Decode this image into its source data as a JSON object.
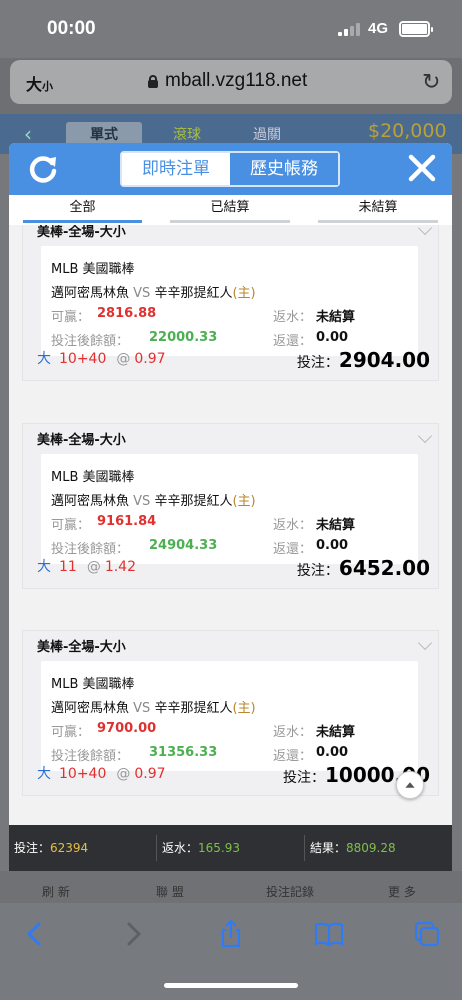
{
  "status_bar": {
    "time": "00:00",
    "network": "4G"
  },
  "url_bar": {
    "reader_label_big": "大",
    "reader_label_small": "小",
    "url": "mball.vzg118.net"
  },
  "background_site": {
    "tabs": [
      "單式",
      "滾球",
      "過關"
    ],
    "balance": "$20,000",
    "bottom_nav": [
      "刷 新",
      "聯 盟",
      "投注記錄",
      "更 多"
    ]
  },
  "modal": {
    "segments": [
      "即時注單",
      "歷史帳務"
    ],
    "filter_tabs": [
      "全部",
      "已結算",
      "未結算"
    ],
    "first_card_title": "美棒-全場-大小",
    "cards": [
      {
        "title": "美棒-全場-大小",
        "league": "MLB 美國職棒",
        "team_away": "邁阿密馬林魚",
        "vs": "VS",
        "team_home": "辛辛那提紅人",
        "home_marker": "(主)",
        "win_label": "可贏：",
        "win_value": "2816.88",
        "remaining_label": "投注後餘額：",
        "remaining_value": "22000.33",
        "rebate_label": "返水：",
        "rebate_value": "未結算",
        "return_label": "返還：",
        "return_value": "0.00",
        "pick_side": "大",
        "pick_line": "10+40",
        "at": "@",
        "odds": "0.97",
        "stake_label": "投注：",
        "stake_value": "2904.00"
      },
      {
        "title": "美棒-全場-大小",
        "league": "MLB 美國職棒",
        "team_away": "邁阿密馬林魚",
        "vs": "VS",
        "team_home": "辛辛那提紅人",
        "home_marker": "(主)",
        "win_label": "可贏：",
        "win_value": "9161.84",
        "remaining_label": "投注後餘額：",
        "remaining_value": "24904.33",
        "rebate_label": "返水：",
        "rebate_value": "未結算",
        "return_label": "返還：",
        "return_value": "0.00",
        "pick_side": "大",
        "pick_line": "11",
        "at": "@",
        "odds": "1.42",
        "stake_label": "投注：",
        "stake_value": "6452.00"
      },
      {
        "title": "美棒-全場-大小",
        "league": "MLB 美國職棒",
        "team_away": "邁阿密馬林魚",
        "vs": "VS",
        "team_home": "辛辛那提紅人",
        "home_marker": "(主)",
        "win_label": "可贏：",
        "win_value": "9700.00",
        "remaining_label": "投注後餘額：",
        "remaining_value": "31356.33",
        "rebate_label": "返水：",
        "rebate_value": "未結算",
        "return_label": "返還：",
        "return_value": "0.00",
        "pick_side": "大",
        "pick_line": "10+40",
        "at": "@",
        "odds": "0.97",
        "stake_label": "投注：",
        "stake_value": "10000.00"
      }
    ]
  },
  "summary": {
    "bet_label": "投注：",
    "bet_value": "62394",
    "rebate_label": "返水：",
    "rebate_value": "165.93",
    "result_label": "結果：",
    "result_value": "8809.28"
  },
  "colors": {
    "accent": "#4a90e2",
    "win": "#e03030",
    "remaining": "#4caf50",
    "home": "#b8862d"
  }
}
